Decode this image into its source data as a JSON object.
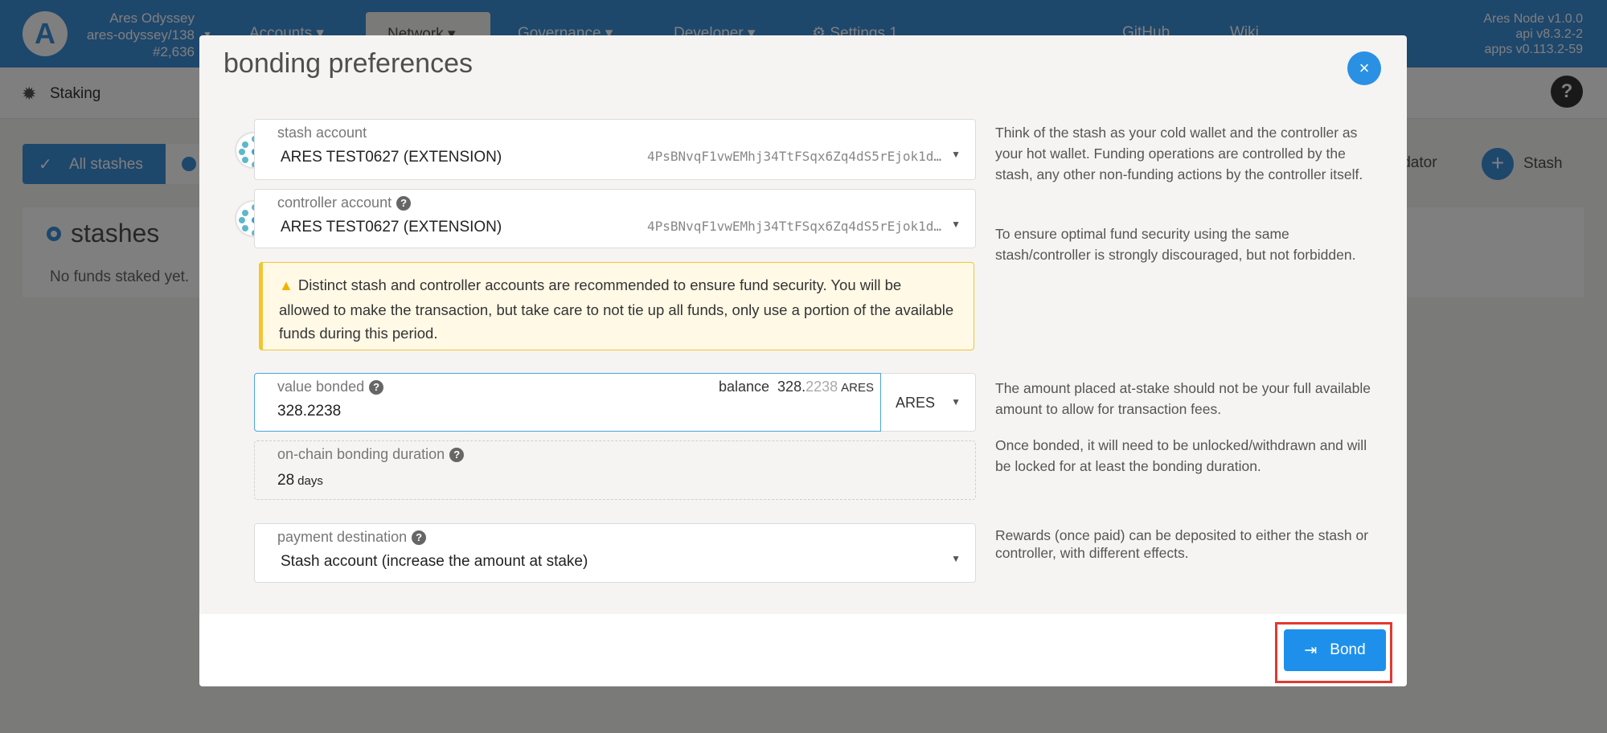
{
  "topbar": {
    "logo_letter": "A",
    "chain_name": "Ares Odyssey",
    "chain_spec": "ares-odyssey/138",
    "block": "#2,636",
    "menu": {
      "accounts": "Accounts",
      "network": "Network",
      "governance": "Governance",
      "developer": "Developer",
      "settings": "Settings",
      "settings_badge": "1",
      "github": "GitHub",
      "wiki": "Wiki"
    },
    "node_version": "Ares Node v1.0.0",
    "api_version": "api v8.3.2-2",
    "apps_version": "apps v0.113.2-59"
  },
  "subbar": {
    "tab": "Staking",
    "help": "?"
  },
  "page": {
    "all_stashes": "All stashes",
    "validator_partial": "idator",
    "stash_button": "Stash",
    "stashes_title": "stashes",
    "empty_text": "No funds staked yet."
  },
  "modal": {
    "title": "bonding preferences",
    "close": "×",
    "stash": {
      "label": "stash account",
      "name": "ARES TEST0627 (EXTENSION)",
      "address": "4PsBNvqF1vwEMhj34TtFSqx6Zq4dS5rEjok1d…"
    },
    "controller": {
      "label": "controller account",
      "name": "ARES TEST0627 (EXTENSION)",
      "address": "4PsBNvqF1vwEMhj34TtFSqx6Zq4dS5rEjok1d…"
    },
    "warning": "Distinct stash and controller accounts are recommended to ensure fund security. You will be allowed to make the transaction, but take care to not tie up all funds, only use a portion of the available funds during this period.",
    "value": {
      "label": "value bonded",
      "amount": "328.2238",
      "balance_label": "balance",
      "balance_int": "328.",
      "balance_dec": "2238",
      "balance_unit": "ARES",
      "unit": "ARES"
    },
    "duration": {
      "label": "on-chain bonding duration",
      "value": "28",
      "unit": "days"
    },
    "payment": {
      "label": "payment destination",
      "value": "Stash account (increase the amount at stake)"
    },
    "help": {
      "stash_p1": "Think of the stash as your cold wallet and the controller as your hot wallet. Funding operations are controlled by the stash, any other non-funding actions by the controller itself.",
      "stash_p2": "To ensure optimal fund security using the same stash/controller is strongly discouraged, but not forbidden.",
      "value": "The amount placed at-stake should not be your full available amount to allow for transaction fees.",
      "duration": "Once bonded, it will need to be unlocked/withdrawn and will be locked for at least the bonding duration.",
      "payment": "Rewards (once paid) can be deposited to either the stash or controller, with different effects."
    },
    "bond_button": "Bond"
  }
}
